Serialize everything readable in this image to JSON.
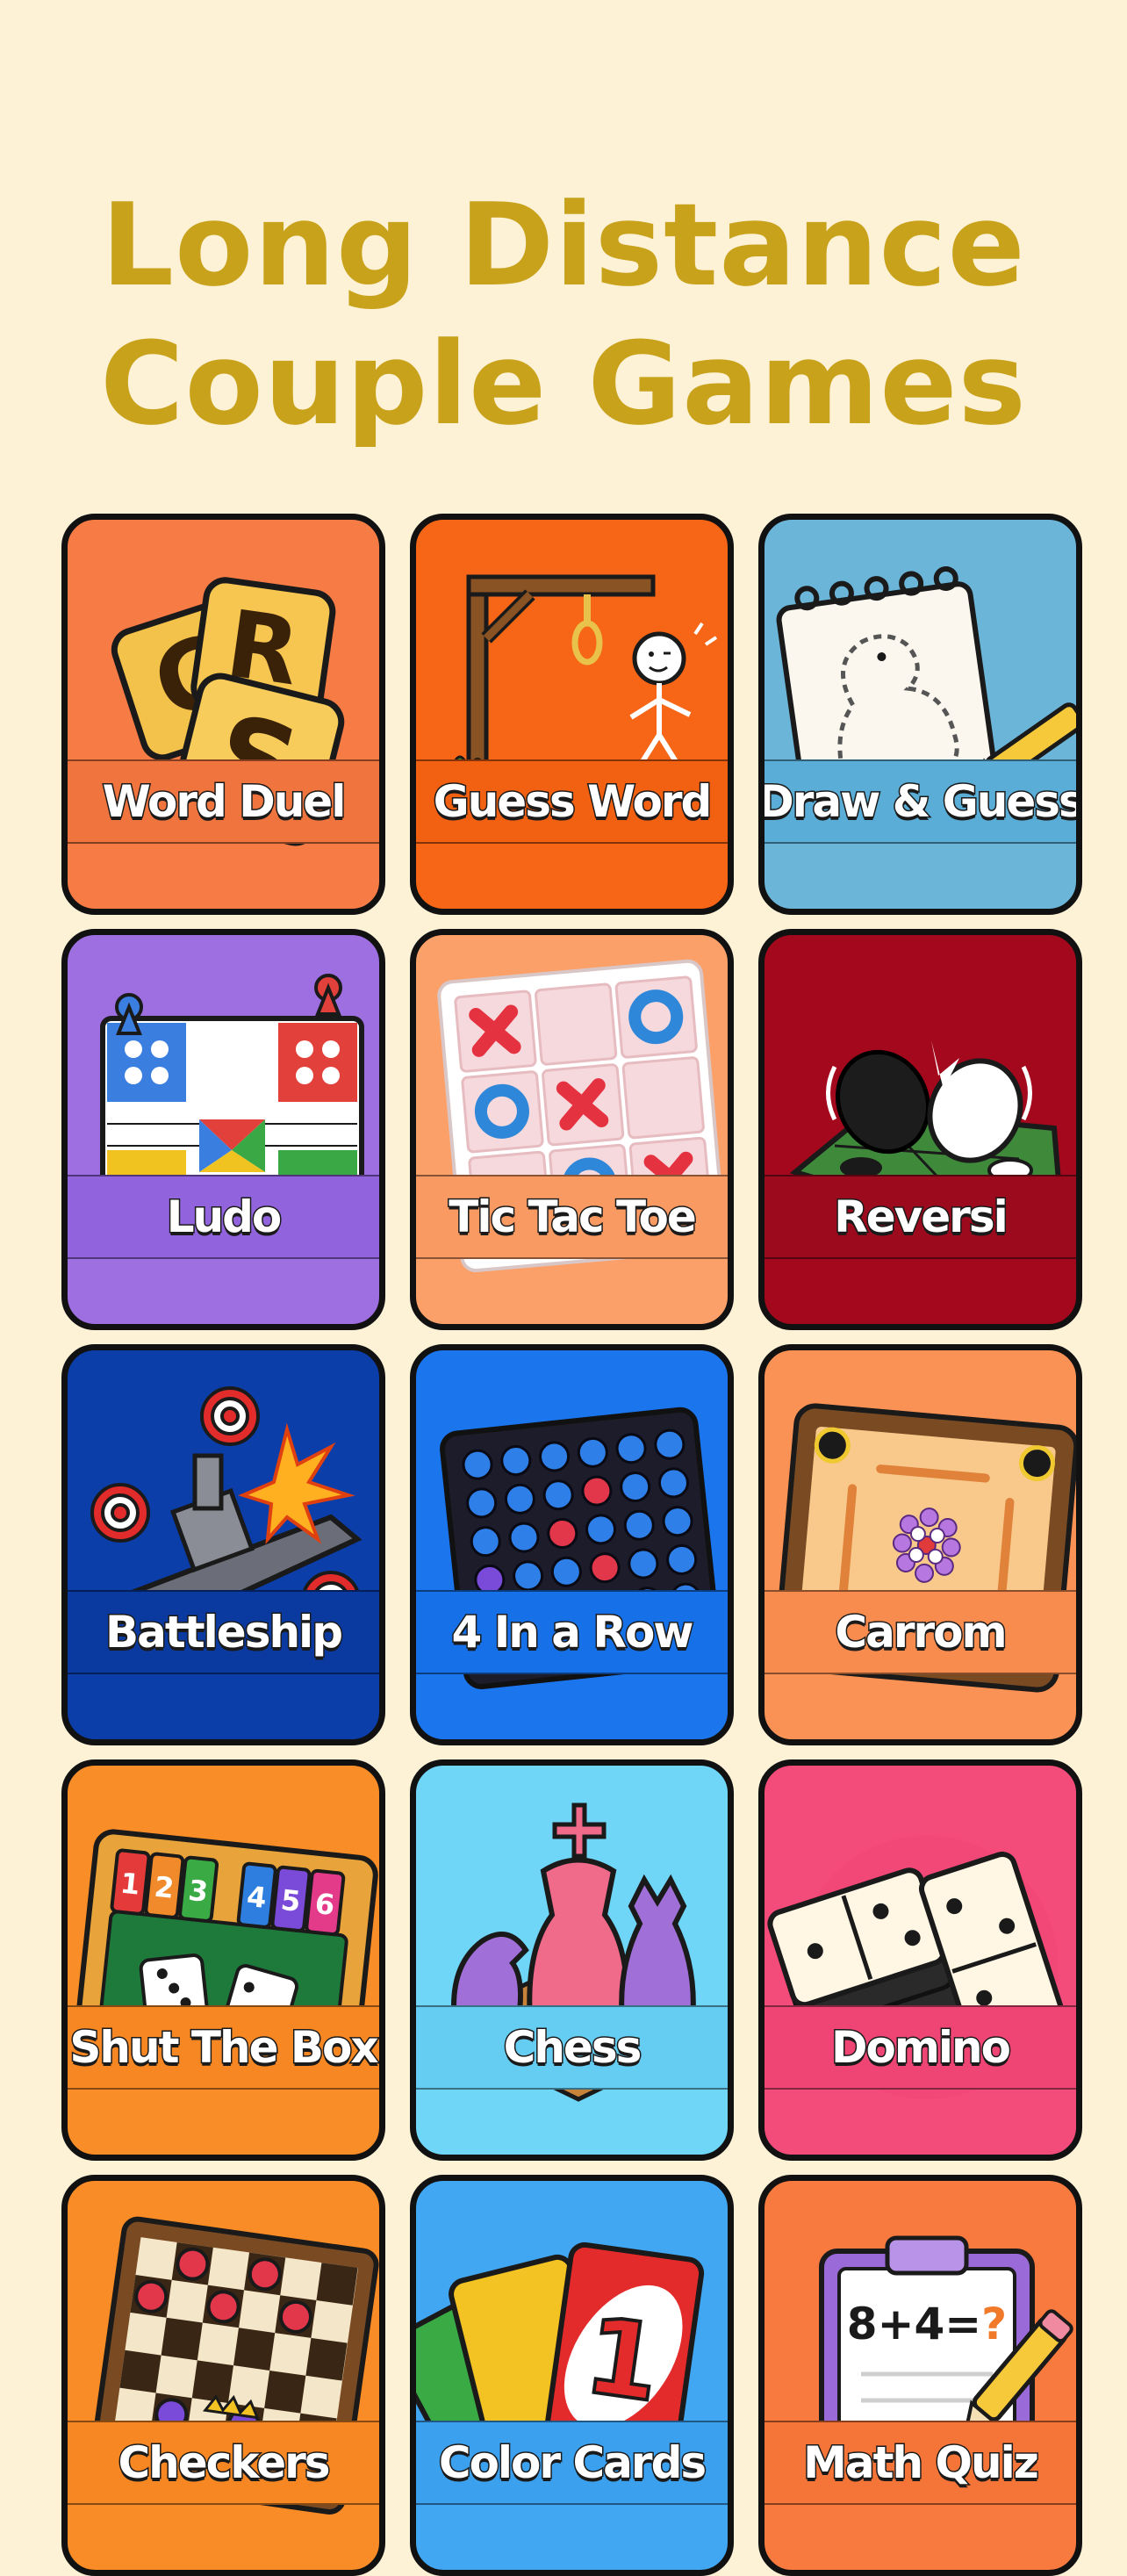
{
  "page": {
    "title_line1": "Long Distance",
    "title_line2": "Couple Games"
  },
  "colors": {
    "background": "#fdf1d6",
    "title": "#c9a21c",
    "card_border": "#111111"
  },
  "games": [
    {
      "label": "Word Duel",
      "icon": "letter-tiles-icon",
      "bg": "#f77b45",
      "band": "#f0743e"
    },
    {
      "label": "Guess Word",
      "icon": "hangman-icon",
      "bg": "#f76516",
      "band": "#f26012"
    },
    {
      "label": "Draw & Guess",
      "icon": "sketchpad-dinosaur-icon",
      "bg": "#6bb5d9",
      "band": "#5aadd6"
    },
    {
      "label": "Ludo",
      "icon": "ludo-board-icon",
      "bg": "#9e6fe0",
      "band": "#9163dc"
    },
    {
      "label": "Tic Tac Toe",
      "icon": "tic-tac-toe-board-icon",
      "bg": "#fca06a",
      "band": "#f99a62"
    },
    {
      "label": "Reversi",
      "icon": "reversi-discs-icon",
      "bg": "#a3081d",
      "band": "#9c0a1e"
    },
    {
      "label": "Battleship",
      "icon": "battleship-icon",
      "bg": "#0b3ea8",
      "band": "#0a3aa0"
    },
    {
      "label": "4 In a Row",
      "icon": "connect-four-grid-icon",
      "bg": "#1b76ee",
      "band": "#1670e8"
    },
    {
      "label": "Carrom",
      "icon": "carrom-board-icon",
      "bg": "#fb9255",
      "band": "#f88c4f"
    },
    {
      "label": "Shut The Box",
      "icon": "shut-the-box-icon",
      "bg": "#f98d27",
      "band": "#f68722"
    },
    {
      "label": "Chess",
      "icon": "chess-pieces-icon",
      "bg": "#6fd6f8",
      "band": "#66cdf2"
    },
    {
      "label": "Domino",
      "icon": "domino-tiles-icon",
      "bg": "#f34b7a",
      "band": "#ef4575"
    },
    {
      "label": "Checkers",
      "icon": "checkers-board-icon",
      "bg": "#f98c26",
      "band": "#f68722"
    },
    {
      "label": "Color Cards",
      "icon": "uno-cards-icon",
      "bg": "#42a7f2",
      "band": "#3ba0ee"
    },
    {
      "label": "Math Quiz",
      "icon": "math-clipboard-icon",
      "bg": "#f97a3e",
      "band": "#f57438"
    }
  ]
}
